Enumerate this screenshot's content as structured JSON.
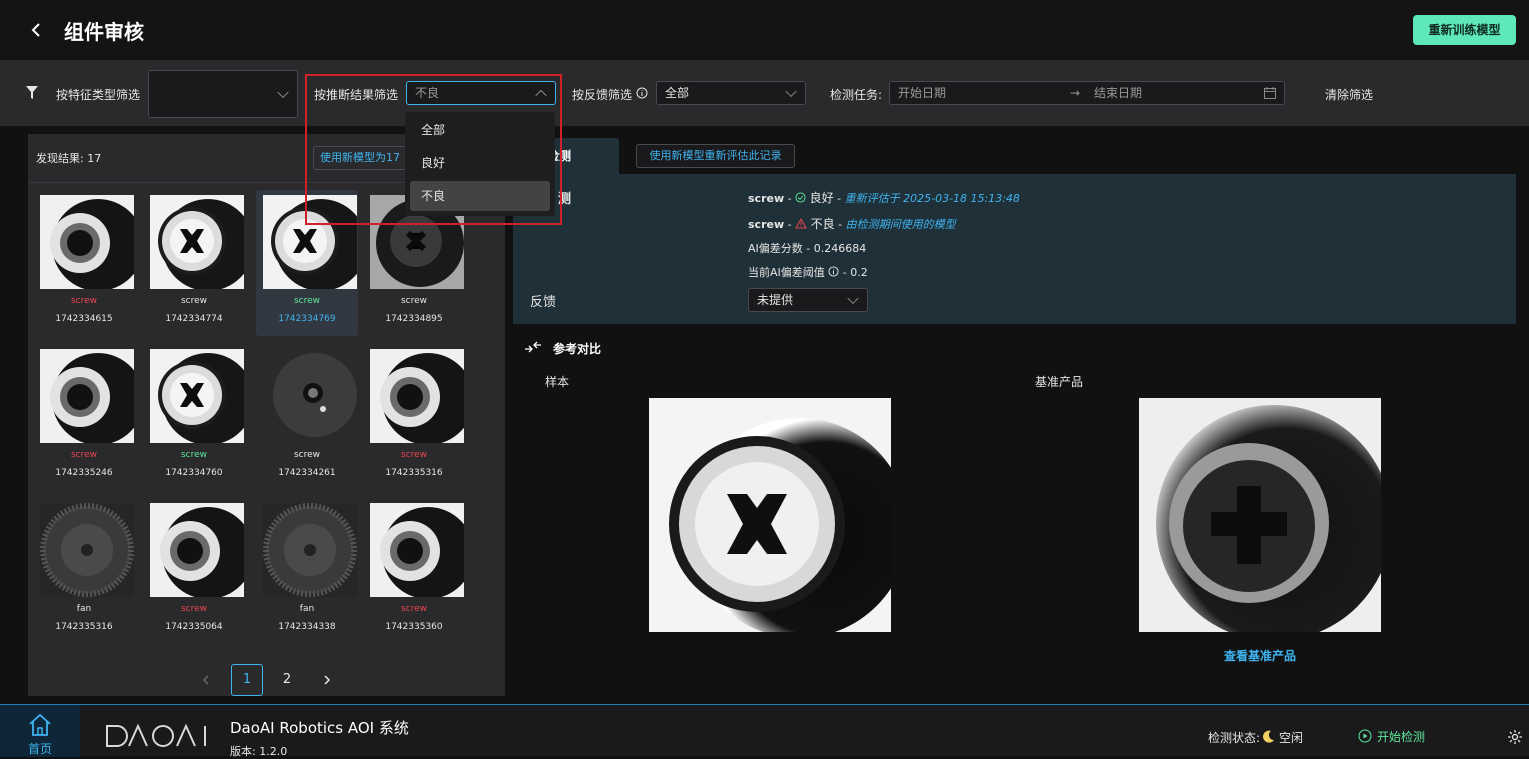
{
  "header": {
    "title": "组件审核",
    "retrain_label": "重新训练模型"
  },
  "filters": {
    "feature_type_label": "按特征类型筛选",
    "feature_type_value": "",
    "infer_result_label": "按推断结果筛选",
    "infer_result_value": "不良",
    "feedback_label": "按反馈筛选",
    "feedback_value": "全部",
    "task_label": "检测任务:",
    "start_placeholder": "开始日期",
    "end_placeholder": "结束日期",
    "arrow": "→",
    "clear_label": "清除筛选"
  },
  "dropdown": {
    "options": [
      "全部",
      "良好",
      "不良"
    ],
    "selected_index": 2
  },
  "results": {
    "label": "发现结果: 17",
    "new_model_btn": "使用新模型为17",
    "items": [
      {
        "name": "screw",
        "id": "1742334615",
        "status": "bad",
        "variant": "ring"
      },
      {
        "name": "screw",
        "id": "1742334774",
        "status": "neutral",
        "variant": "cross"
      },
      {
        "name": "screw",
        "id": "1742334769",
        "status": "good",
        "variant": "cross",
        "selected": true
      },
      {
        "name": "screw",
        "id": "1742334895",
        "status": "neutral",
        "variant": "dark"
      },
      {
        "name": "screw",
        "id": "1742335246",
        "status": "bad",
        "variant": "ring"
      },
      {
        "name": "screw",
        "id": "1742334760",
        "status": "good",
        "variant": "cross"
      },
      {
        "name": "screw",
        "id": "1742334261",
        "status": "neutral",
        "variant": "plate"
      },
      {
        "name": "screw",
        "id": "1742335316",
        "status": "bad",
        "variant": "ring"
      },
      {
        "name": "fan",
        "id": "1742335316",
        "status": "neutral",
        "variant": "fan"
      },
      {
        "name": "screw",
        "id": "1742335064",
        "status": "bad",
        "variant": "ring"
      },
      {
        "name": "fan",
        "id": "1742334338",
        "status": "neutral",
        "variant": "fan"
      },
      {
        "name": "screw",
        "id": "1742335360",
        "status": "bad",
        "variant": "ring"
      }
    ]
  },
  "pagination": {
    "pages": [
      "1",
      "2"
    ],
    "current": "1"
  },
  "detail": {
    "tab_label": "缺陷检测",
    "tab_visible": "缺陷检测",
    "reeval_label": "使用新模型重新评估此记录",
    "section_label": "测",
    "line1": {
      "feature": "screw",
      "sep": "-",
      "result": "良好",
      "note": "重新评估于 2025-03-18 15:13:48"
    },
    "line2": {
      "feature": "screw",
      "sep": "-",
      "result": "不良",
      "note": "由检测期间使用的模型"
    },
    "ai_score": "AI偏差分数 - 0.246684",
    "threshold_label": "当前AI偏差阈值",
    "threshold_value": "- 0.2",
    "feedback_label": "反馈",
    "feedback_value": "未提供"
  },
  "reference": {
    "title": "参考对比",
    "sample_label": "样本",
    "base_label": "基准产品",
    "view_base": "查看基准产品"
  },
  "bottombar": {
    "home_label": "首页",
    "logo_text": "DAOAI",
    "app_title": "DaoAI Robotics AOI 系统",
    "version": "版本: 1.2.0",
    "status_label": "检测状态:",
    "status_value": "空闲",
    "start_label": "开始检测"
  },
  "colors": {
    "accent_blue": "#3fb4f0",
    "good_green": "#5ee89a",
    "bad_red": "#e8454d",
    "retrain_bg": "#5ee8b8",
    "highlight_red": "#d0202a"
  }
}
